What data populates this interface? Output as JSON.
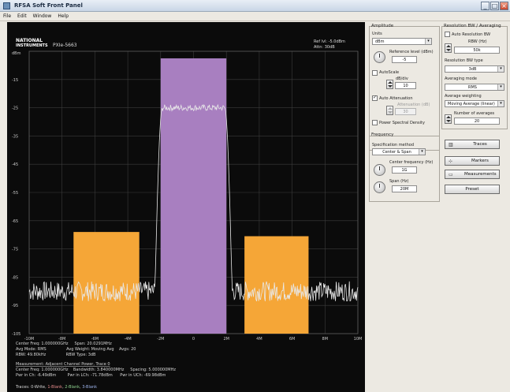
{
  "window": {
    "title": "RFSA Soft Front Panel"
  },
  "menu": [
    "File",
    "Edit",
    "Window",
    "Help"
  ],
  "plot_header": {
    "logo_line1": "NATIONAL",
    "logo_line2": "INSTRUMENTS",
    "device": "PXIe-5663",
    "ref_lvl": "Ref lvl: -5.0dBm",
    "attn": "Attn: 30dB"
  },
  "chart_data": {
    "type": "line",
    "ylabel": "dBm",
    "ylim": [
      -105,
      -5
    ],
    "xlim": [
      -10,
      10
    ],
    "y_ticks": [
      "-15",
      "-25",
      "-35",
      "-45",
      "-55",
      "-65",
      "-75",
      "-85",
      "-95",
      "-105"
    ],
    "x_ticks": [
      "-10M",
      "-8M",
      "-6M",
      "-4M",
      "-2M",
      "0",
      "2M",
      "4M",
      "6M",
      "8M",
      "10M"
    ],
    "bands": [
      {
        "name": "Lower adjacent channel",
        "x": [
          -7.3,
          -3.3
        ],
        "level": -69.0,
        "color": "#f5a637"
      },
      {
        "name": "Main channel",
        "x": [
          -2.0,
          2.0
        ],
        "level": -7.5,
        "color": "#a87fc0"
      },
      {
        "name": "Upper adjacent channel",
        "x": [
          3.1,
          7.0
        ],
        "level": -70.5,
        "color": "#f5a637"
      }
    ],
    "trace": {
      "name": "Trace 0",
      "noise_floor": -90,
      "signal_level": -25,
      "signal_edges": [
        -2.2,
        2.2
      ]
    }
  },
  "info_lines": [
    "Center Freq: 1.000000GHz     Span: 20.0291MHz",
    "Avg Mode: RMS                Avg Weight: Moving Avg    Avgs: 20",
    "RBW: 49.80kHz                RBW Type: 3dB"
  ],
  "measurement_title": "Measurement: Adjacent Channel Power, Trace 0",
  "measurement_lines": [
    "Center Freq: 1.000000GHz    Bandwidth: 3.840000MHz     Spacing: 5.000000MHz",
    "Pwr in Ch: -6.49dBm         Pwr in LCh: -71.78dBm      Pwr in UCh: -69.98dBm"
  ],
  "traces_line": {
    "prefix": "Traces: 0-Write, ",
    "t1": "1-Blank",
    "t2": "2-Blank",
    "t3": "3-Blank",
    "sep": ", "
  },
  "amplitude": {
    "title": "Amplitude",
    "units_label": "Units",
    "units_value": "dBm",
    "ref_level_label": "Reference level (dBm)",
    "ref_level_value": "-5",
    "autoscale_label": "AutoScale",
    "dbdiv_label": "dB/div",
    "dbdiv_value": "10",
    "auto_attenuation_label": "Auto Attenuation",
    "attenuation_label": "Attenuation (dB)",
    "attenuation_value": "30",
    "psd_label": "Power Spectral Density"
  },
  "resolution": {
    "title": "Resolution BW / Averaging",
    "auto_rbw_label": "Auto Resolution BW",
    "rbw_label": "RBW (Hz)",
    "rbw_value": "50k",
    "rbw_type_label": "Resolution BW type",
    "rbw_type_value": "3dB",
    "avg_mode_label": "Averaging mode",
    "avg_mode_value": "RMS",
    "avg_weight_label": "Average weighting",
    "avg_weight_value": "Moving Average (linear)",
    "num_avg_label": "Number of averages",
    "num_avg_value": "20"
  },
  "frequency": {
    "title": "Frequency",
    "spec_method_label": "Specification method",
    "spec_method_value": "Center & Span",
    "center_label": "Center frequency (Hz)",
    "center_value": "1G",
    "span_label": "Span (Hz)",
    "span_value": "20M"
  },
  "buttons": {
    "traces": "Traces",
    "markers": "Markers",
    "measurements": "Measurements",
    "preset": "Preset"
  },
  "colors": {
    "plot_bg": "#0b0b0b",
    "grid": "#3d3d3d",
    "main_band": "#a87fc0",
    "adjacent_band": "#f5a637",
    "trace": "#e8e8e8",
    "trace_t1": "#e58b8b",
    "trace_t2": "#8fd18f",
    "trace_t3": "#9fb6ee"
  }
}
